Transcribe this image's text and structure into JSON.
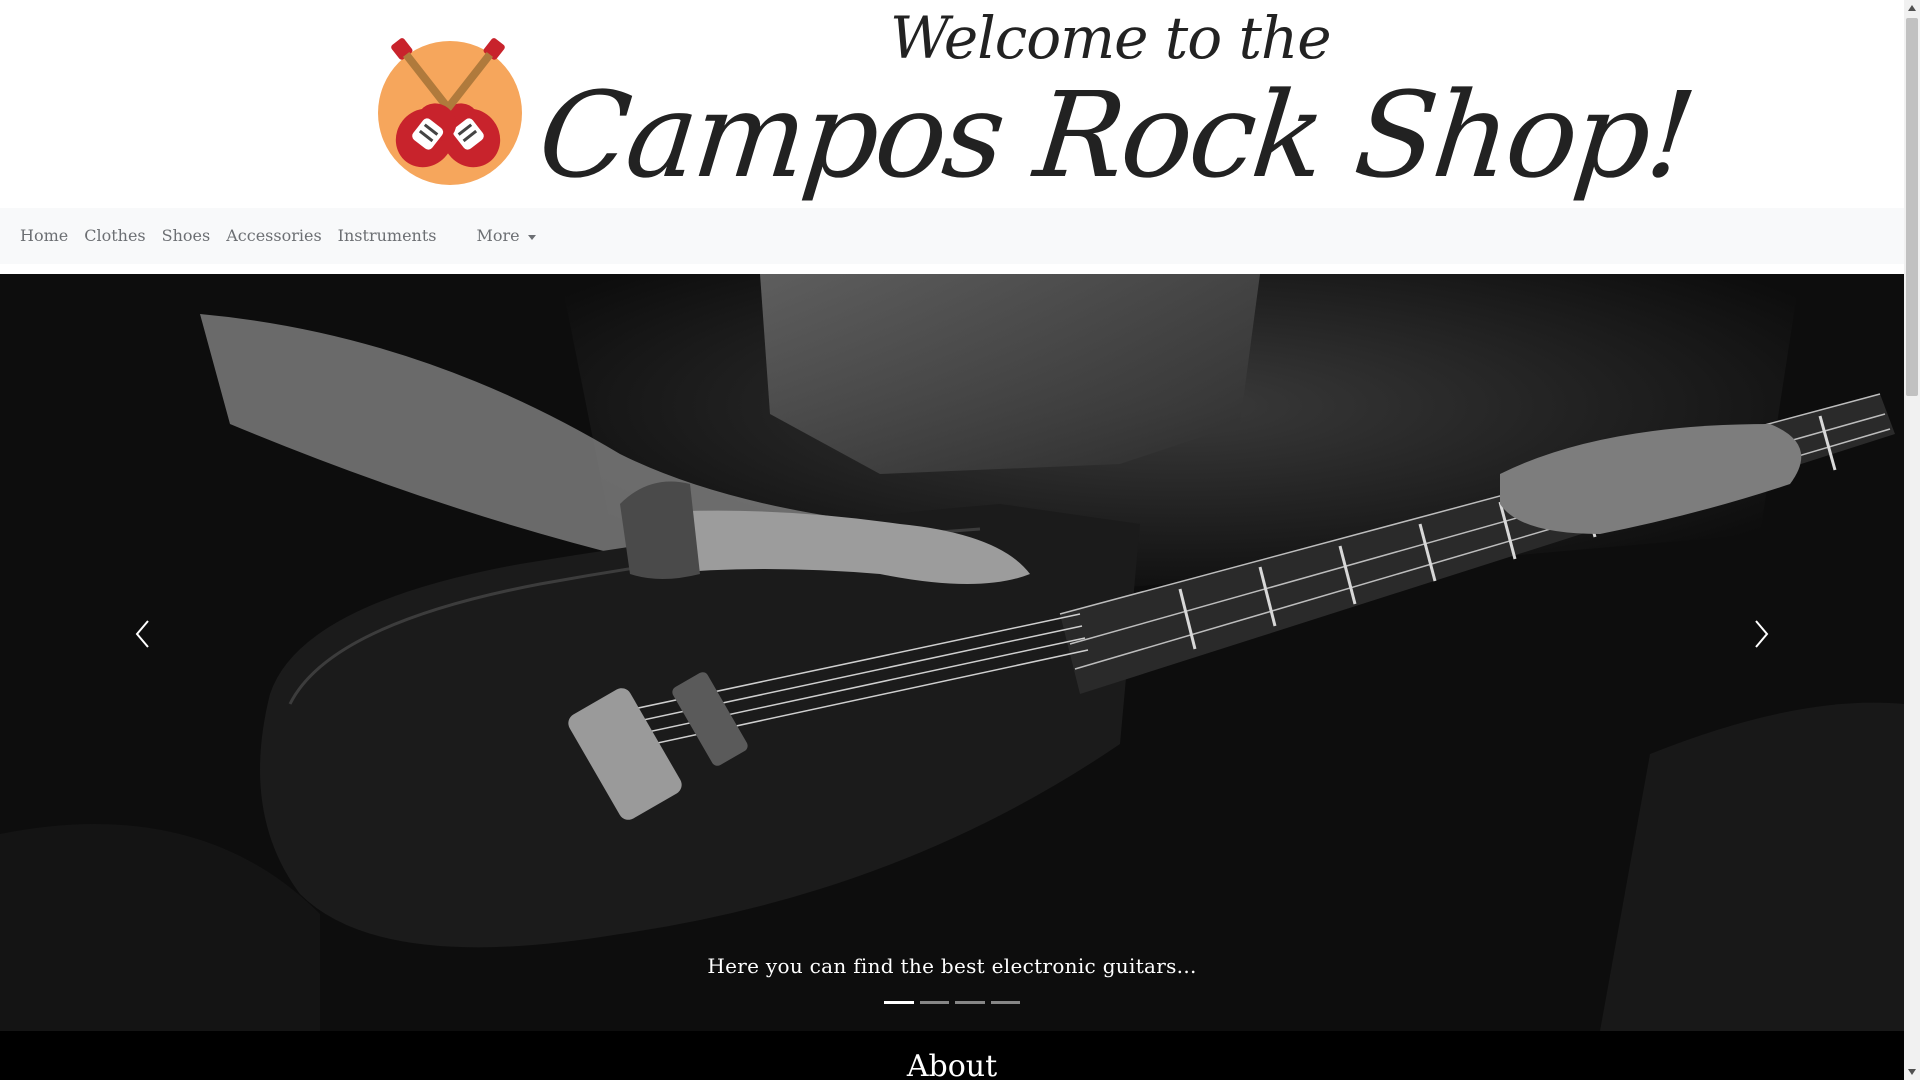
{
  "header": {
    "welcome": "Welcome to the",
    "shop_name": "Campos Rock Shop!",
    "logo_icon": "crossed-guitars-logo"
  },
  "nav": {
    "items": [
      {
        "label": "Home"
      },
      {
        "label": "Clothes"
      },
      {
        "label": "Shoes"
      },
      {
        "label": "Accessories"
      },
      {
        "label": "Instruments"
      }
    ],
    "more_label": "More"
  },
  "carousel": {
    "caption": "Here you can find the best electronic guitars...",
    "slide_count": 4,
    "active_slide": 1,
    "prev_icon": "chevron-left-icon",
    "next_icon": "chevron-right-icon"
  },
  "about": {
    "title": "About"
  },
  "colors": {
    "nav_bg": "#f8f9fa",
    "nav_text": "#6c6f73",
    "logo_sun": "#f6a65c",
    "guitar_red": "#c8232c",
    "carousel_bg": "#0d0d0d"
  }
}
